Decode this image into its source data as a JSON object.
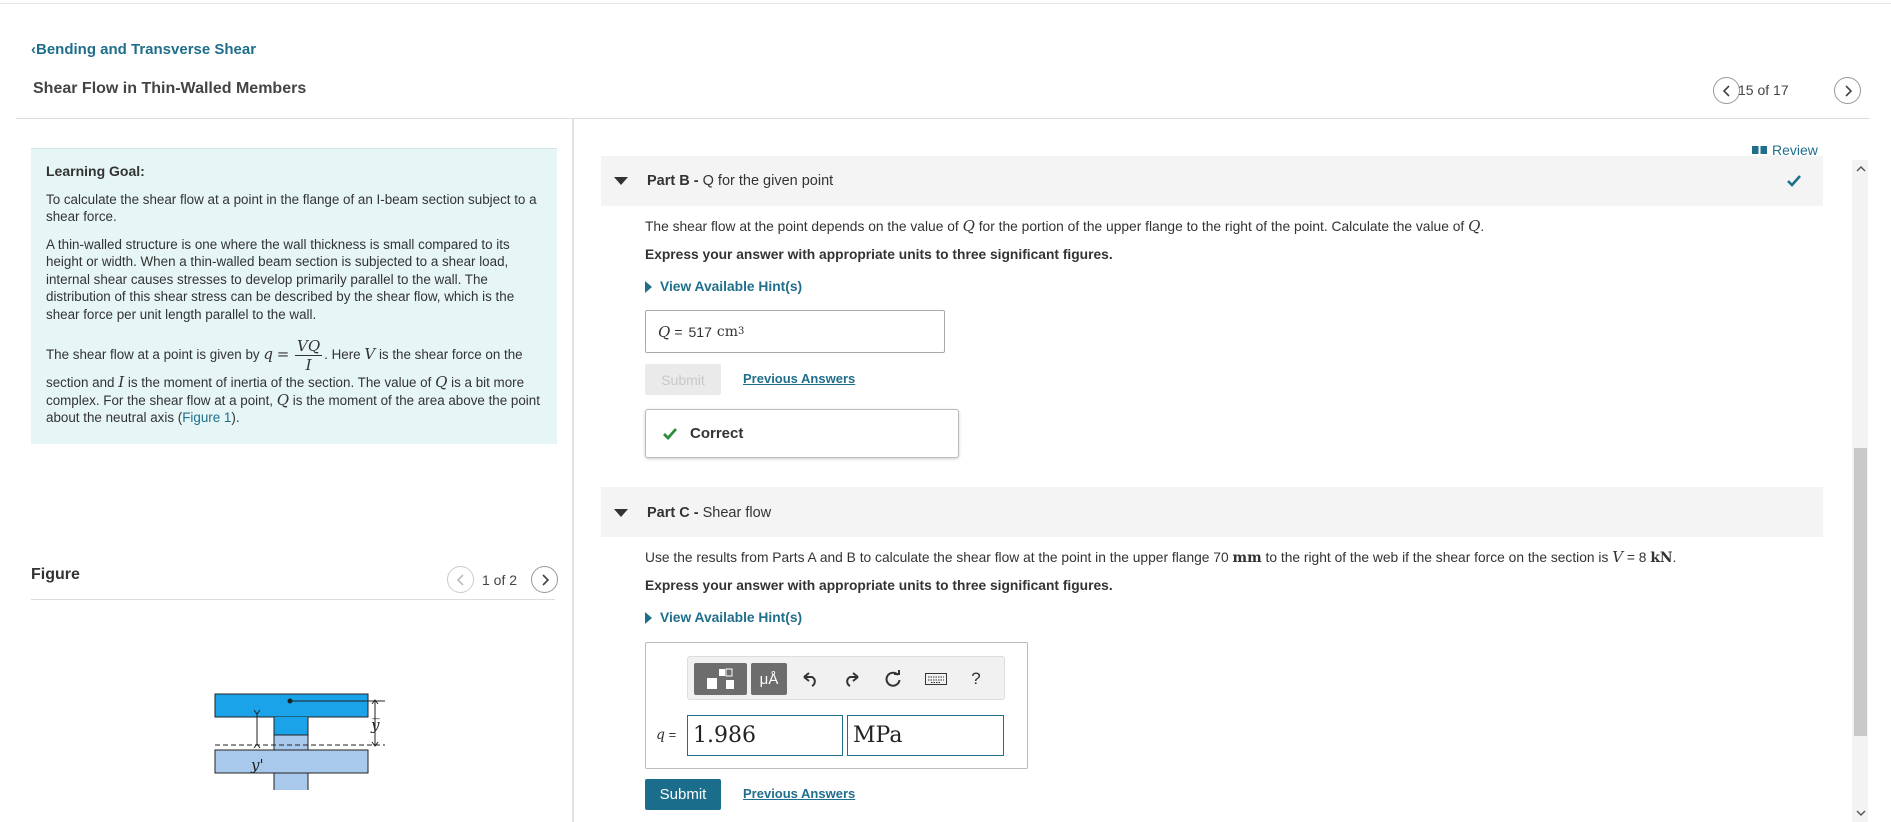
{
  "header": {
    "back_label": "Bending and Transverse Shear",
    "title": "Shear Flow in Thin-Walled Members",
    "nav_count": "15 of 17"
  },
  "learning_goal": {
    "title": "Learning Goal:",
    "p1": "To calculate the shear flow at a point in the flange of an I-beam section subject to a shear force.",
    "p2": "A thin-walled structure is one where the wall thickness is small compared to its height or width. When a thin-walled beam section is subjected to a shear load, internal shear causes stresses to develop primarily parallel to the wall. The distribution of this shear stress can be described by the shear flow, which is the shear force per unit length parallel to the wall.",
    "p3_pre": "The shear flow at a point is given by",
    "p3_q": "q",
    "p3_eq": "=",
    "p3_num": "VQ",
    "p3_den": "I",
    "p3_a": ". Here",
    "p3_V": "V",
    "p3_b": "is the shear force on the section and",
    "p3_I": "I",
    "p3_c": "is the moment of inertia of the section. The value of",
    "p3_Q": "Q",
    "p3_d": "is a bit more complex. For the shear flow at a point,",
    "p3_Q2": "Q",
    "p3_e": "is the moment of the area above the point about the neutral axis (",
    "p3_link": "Figure 1",
    "p3_f": ")."
  },
  "figure": {
    "title": "Figure",
    "count": "1 of 2",
    "label_y_bar": "y̅",
    "label_y_prime": "y'"
  },
  "review_label": "Review",
  "part_b": {
    "prefix": "Part B -",
    "title": "Q for the given point",
    "text_pre": "The shear flow at the point depends on the value of",
    "Q": "Q",
    "text_mid": "for the portion of the upper flange to the right of the point. Calculate the value of",
    "Q2": "Q",
    "text_end": ".",
    "instruction": "Express your answer with appropriate units to three significant figures.",
    "hint_label": "View Available Hint(s)",
    "answer_var": "Q",
    "answer_eq": "=",
    "answer_value": "517",
    "answer_unit": "cm",
    "answer_exp": "3",
    "submit_label": "Submit",
    "prev_answers": "Previous Answers",
    "correct_label": "Correct"
  },
  "part_c": {
    "prefix": "Part C -",
    "title": "Shear flow",
    "text_pre": "Use the results from Parts A and B to calculate the shear flow at the point in the upper flange 70",
    "unit_mm": "mm",
    "text_mid": "to the right of the web if the shear force on the section is",
    "V": "V",
    "v_eq": "= 8",
    "unit_kN": "kN",
    "text_end": ".",
    "instruction": "Express your answer with appropriate units to three significant figures.",
    "hint_label": "View Available Hint(s)",
    "toolbar_units": "μÅ",
    "toolbar_help": "?",
    "var_label": "q",
    "var_eq": "=",
    "value": "1.986",
    "unit": "MPa",
    "submit_label": "Submit",
    "prev_answers": "Previous Answers"
  },
  "colors": {
    "accent": "#1f6e8c",
    "goal_bg": "#e6f5f6",
    "correct_green": "#2e8b3a",
    "beam_top": "#1aa3e8",
    "beam_bottom": "#a9c9ec"
  }
}
